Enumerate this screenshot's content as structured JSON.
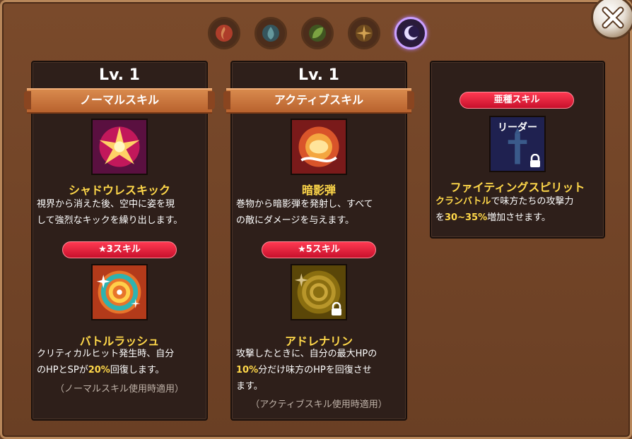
{
  "elements": [
    "fire-element",
    "water-element",
    "wind-element",
    "light-element",
    "dark-element"
  ],
  "active_element": "dark-element",
  "panels": [
    {
      "level": "Lv. 1",
      "ribbon": "ノーマルスキル",
      "skill_name": "シャドウレスキック",
      "desc_line1": "視界から消えた後、空中に姿を現",
      "desc_line2": "して強烈なキックを繰り出します。",
      "sub_badge": "★3スキル",
      "sub_name": "バトルラッシュ",
      "sub_line1": "クリティカルヒット発生時、自分",
      "sub_line2_a": "のHPとSPが",
      "sub_line2_hl": "20%",
      "sub_line2_b": "回復します。",
      "sub_note": "（ノーマルスキル使用時適用）"
    },
    {
      "level": "Lv. 1",
      "ribbon": "アクティブスキル",
      "skill_name": "暗影弾",
      "desc_line1": "巻物から暗影弾を発射し、すべて",
      "desc_line2": "の敵にダメージを与えます。",
      "sub_badge": "★5スキル",
      "sub_name": "アドレナリン",
      "sub_line1": "攻撃したときに、自分の最大HPの",
      "sub_line2_hl": "10%",
      "sub_line2_b": "分だけ味方のHPを回復させ",
      "sub_line3": "ます。",
      "sub_note": "（アクティブスキル使用時適用）"
    },
    {
      "badge": "亜種スキル",
      "icon_label": "リーダー",
      "skill_name": "ファイティングスピリット",
      "line1_hl": "クランバトル",
      "line1_b": "で味方たちの攻撃力",
      "line2_a": "を",
      "line2_hl": "30~35%",
      "line2_b": "増加させます。"
    }
  ],
  "colors": {
    "accent_yellow": "#ffd84a",
    "badge_red": "#e0203a",
    "ribbon_orange": "#c8703a"
  }
}
